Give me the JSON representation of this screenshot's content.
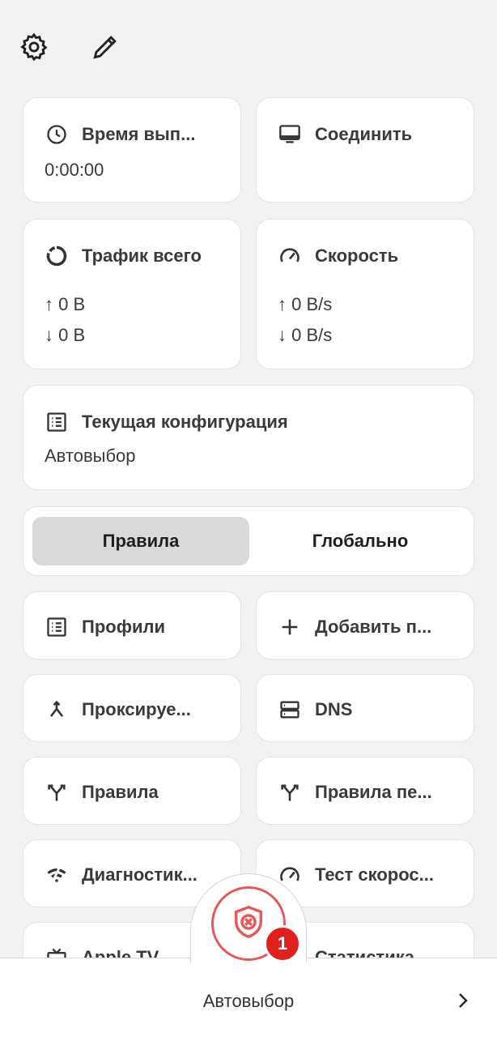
{
  "cards": {
    "uptime": {
      "title": "Время вып...",
      "value": "0:00:00"
    },
    "connect": {
      "title": "Соединить"
    },
    "traffic": {
      "title": "Трафик всего",
      "up": "↑ 0 B",
      "down": "↓ 0 B"
    },
    "speed": {
      "title": "Скорость",
      "up": "↑ 0 B/s",
      "down": "↓ 0 B/s"
    },
    "config": {
      "title": "Текущая конфигурация",
      "value": "Автовыбор"
    }
  },
  "mode": {
    "rules": "Правила",
    "global": "Глобально",
    "selected": "rules"
  },
  "menu": [
    {
      "label": "Профили",
      "icon": "list-icon"
    },
    {
      "label": "Добавить п...",
      "icon": "plus-icon"
    },
    {
      "label": "Проксируе...",
      "icon": "merge-icon"
    },
    {
      "label": "DNS",
      "icon": "dns-server-icon"
    },
    {
      "label": "Правила",
      "icon": "fork-icon"
    },
    {
      "label": "Правила пе...",
      "icon": "fork-icon"
    },
    {
      "label": "Диагностик...",
      "icon": "wifi-off-icon"
    },
    {
      "label": "Тест скорос...",
      "icon": "speedometer-icon"
    },
    {
      "label": "Apple TV",
      "icon": "tv-icon"
    },
    {
      "label": "Статистика",
      "icon": "chart-icon"
    }
  ],
  "bottom": {
    "label": "Автовыбор",
    "badge": "1"
  },
  "colors": {
    "accent_red": "#e01f1f",
    "card_bg": "#ffffff",
    "page_bg": "#f2f2f2"
  }
}
